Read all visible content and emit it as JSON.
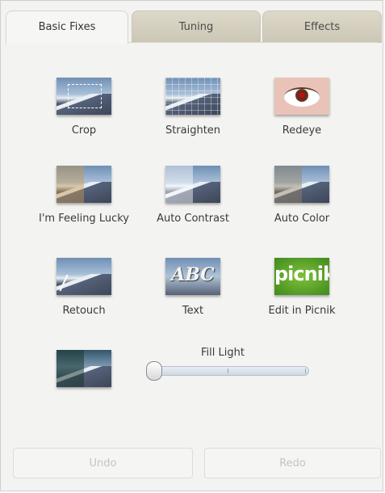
{
  "tabs": [
    {
      "label": "Basic Fixes",
      "active": true
    },
    {
      "label": "Tuning",
      "active": false
    },
    {
      "label": "Effects",
      "active": false
    }
  ],
  "tools": {
    "crop": "Crop",
    "straighten": "Straighten",
    "redeye": "Redeye",
    "lucky": "I'm Feeling Lucky",
    "auto_contrast": "Auto Contrast",
    "auto_color": "Auto Color",
    "retouch": "Retouch",
    "text": "Text",
    "edit_picnik": "Edit in Picnik"
  },
  "thumb_text": {
    "abc": "ABC",
    "picnik": "picnik"
  },
  "fill_light": {
    "label": "Fill Light",
    "value": 0
  },
  "buttons": {
    "undo": "Undo",
    "redo": "Redo"
  },
  "colors": {
    "panel_bg": "#f3f3f1",
    "tab_inactive": "#d3cebd",
    "picnik_green": "#5ea52a",
    "disabled_text": "#c4c4c4"
  }
}
